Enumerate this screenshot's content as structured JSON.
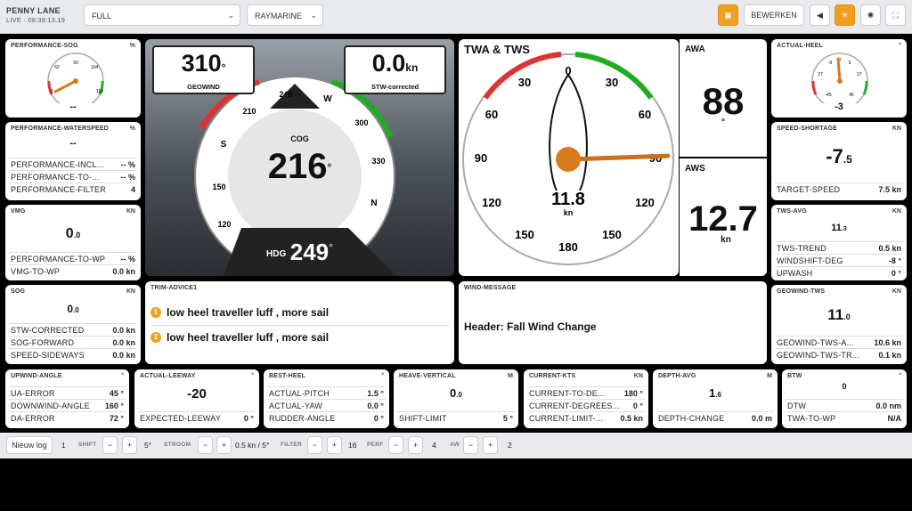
{
  "app": {
    "brand": "PENNY LANE",
    "live": "LIVE · 08:39:13.19",
    "layout_select": "FULL",
    "source_select": "RAYMARINE",
    "edit_label": "BEWERKEN"
  },
  "perf_sog": {
    "title": "PERFORMANCE-SOG",
    "unit": "%",
    "value": "--",
    "ticks": [
      "0",
      "62",
      "93",
      "104",
      "115"
    ],
    "needle_fraction": 0.06
  },
  "perf_ws": {
    "title": "PERFORMANCE-WATERSPEED",
    "unit": "%",
    "value": "--",
    "rows": [
      {
        "k": "PERFORMANCE-INCL...",
        "v": "-- %"
      },
      {
        "k": "PERFORMANCE-TO-...",
        "v": "-- %"
      },
      {
        "k": "PERFORMANCE-FILTER",
        "v": "4"
      }
    ]
  },
  "vmg": {
    "title": "VMG",
    "unit": "KN",
    "value": "0",
    "decimal": ".0",
    "rows": [
      {
        "k": "PERFORMANCE-TO-WP",
        "v": "-- %"
      },
      {
        "k": "VMG-TO-WP",
        "v": "0.0 kn"
      }
    ]
  },
  "sog": {
    "title": "SOG",
    "unit": "KN",
    "value": "0",
    "decimal": ".0",
    "rows": [
      {
        "k": "STW-CORRECTED",
        "v": "0.0 kn"
      },
      {
        "k": "SOG-FORWARD",
        "v": "0.0 kn"
      },
      {
        "k": "SPEED-SIDEWAYS",
        "v": "0.0 kn"
      }
    ]
  },
  "compass": {
    "geowind_value": "310",
    "geowind_unit": "°",
    "geowind_label": "GEOWIND",
    "stw_value": "0.0",
    "stw_unit": "kn",
    "stw_label": "STW-corrected",
    "cog_label": "COG",
    "cog_value": "216",
    "cog_unit": "°",
    "hdg_label": "HDG",
    "hdg_value": "249",
    "hdg_unit": "°",
    "labels": [
      "120",
      "150",
      "S",
      "210",
      "240",
      "W",
      "300",
      "330",
      "N"
    ]
  },
  "twa": {
    "title": "TWA & TWS",
    "speed": "11.8",
    "speed_unit": "kn",
    "labels": [
      "0",
      "30",
      "30",
      "60",
      "60",
      "90",
      "90",
      "120",
      "120",
      "150",
      "150",
      "180"
    ],
    "needle_deg": 88
  },
  "awa": {
    "title": "AWA",
    "value": "88",
    "unit": "°"
  },
  "aws": {
    "title": "AWS",
    "value": "12.7",
    "unit": "kn"
  },
  "heel": {
    "title": "ACTUAL-HEEL",
    "unit": "°",
    "value": "-3",
    "ticks": [
      "-9",
      "0",
      "9",
      "27",
      "27",
      "-45",
      "45"
    ]
  },
  "shortage": {
    "title": "SPEED-SHORTAGE",
    "unit": "KN",
    "value": "-7",
    "decimal": ".5",
    "rows": [
      {
        "k": "TARGET-SPEED",
        "v": "7.5 kn"
      }
    ]
  },
  "tws_avg": {
    "title": "TWS-AVG",
    "unit": "KN",
    "value": "11",
    "decimal": ".3",
    "rows": [
      {
        "k": "TWS-TREND",
        "v": "0.5 kn"
      },
      {
        "k": "WINDSHIFT-DEG",
        "v": "-8 °"
      },
      {
        "k": "UPWASH",
        "v": "0 °"
      }
    ]
  },
  "trim": {
    "title": "TRIM-ADVICE1",
    "items": [
      {
        "n": "1",
        "t": "low heel traveller luff , more sail"
      },
      {
        "n": "2",
        "t": "low heel traveller luff , more sail"
      }
    ]
  },
  "wind_msg": {
    "title": "WIND-MESSAGE",
    "text": "Header: Fall Wind Change"
  },
  "geowind_tws": {
    "title": "GEOWIND-TWS",
    "unit": "KN",
    "value": "11",
    "decimal": ".0",
    "rows": [
      {
        "k": "GEOWIND-TWS-A...",
        "v": "10.6 kn"
      },
      {
        "k": "GEOWIND-TWS-TR...",
        "v": "0.1 kn"
      }
    ]
  },
  "upwind": {
    "title": "UPWIND-ANGLE",
    "unit": "°",
    "rows": [
      {
        "k": "UA-ERROR",
        "v": "45 °"
      },
      {
        "k": "DOWNWIND-ANGLE",
        "v": "160 °"
      },
      {
        "k": "DA-ERROR",
        "v": "72 °"
      }
    ]
  },
  "leeway": {
    "title": "ACTUAL-LEEWAY",
    "unit": "°",
    "value": "-20",
    "rows": [
      {
        "k": "EXPECTED-LEEWAY",
        "v": "0 °"
      }
    ]
  },
  "best_heel": {
    "title": "BEST-HEEL",
    "unit": "°",
    "rows": [
      {
        "k": "ACTUAL-PITCH",
        "v": "1.5 °"
      },
      {
        "k": "ACTUAL-YAW",
        "v": "0.0 °"
      },
      {
        "k": "RUDDER-ANGLE",
        "v": "0 °"
      }
    ]
  },
  "heave": {
    "title": "HEAVE-VERTICAL",
    "unit": "M",
    "value": "0",
    "decimal": ".0",
    "rows": [
      {
        "k": "SHIFT-LIMIT",
        "v": "5 °"
      }
    ]
  },
  "current": {
    "title": "CURRENT-KTS",
    "unit": "KN",
    "rows": [
      {
        "k": "CURRENT-TO-DE...",
        "v": "180 °"
      },
      {
        "k": "CURRENT-DEGREES...",
        "v": "0 °"
      },
      {
        "k": "CURRENT-LIMIT-...",
        "v": "0.5 kn"
      }
    ]
  },
  "depth": {
    "title": "DEPTH-AVG",
    "unit": "M",
    "value": "1",
    "decimal": ".6",
    "rows": [
      {
        "k": "DEPTH-CHANGE",
        "v": "0.0 m"
      }
    ]
  },
  "btw": {
    "title": "BTW",
    "unit": "°",
    "value": "0",
    "rows": [
      {
        "k": "DTW",
        "v": "0.0 nm"
      },
      {
        "k": "TWA-TO-WP",
        "v": "N/A"
      }
    ]
  },
  "footer": {
    "log_label": "Nieuw log",
    "log_value": "1",
    "shift_label": "SHIFT",
    "shift_value": "5°",
    "stroom_label": "STROOM",
    "stroom_value": "0.5 kn / 5°",
    "filter_label": "FILTER",
    "filter_value": "16",
    "perf_label": "PERF",
    "perf_value": "4",
    "aw_label": "AW",
    "aw_value": "2",
    "minus": "−",
    "plus": "+"
  }
}
